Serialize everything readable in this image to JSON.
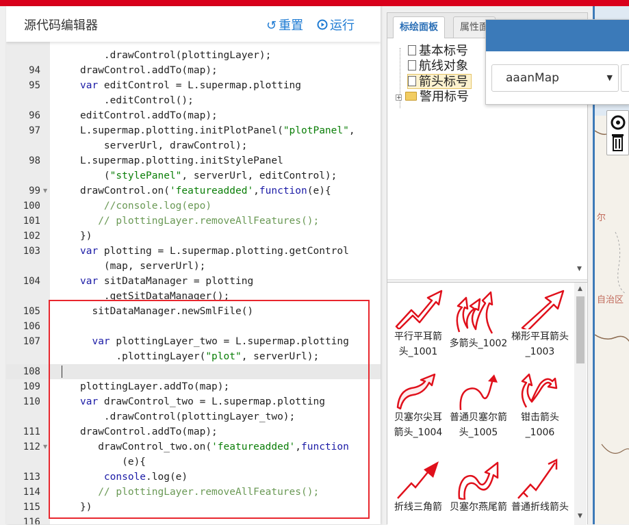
{
  "editor": {
    "title": "源代码编辑器",
    "reset_label": "重置",
    "run_label": "运行"
  },
  "code_lines": [
    {
      "num": "",
      "segs": [
        {
          "t": "    .drawControl(plottingLayer);",
          "c": ""
        }
      ]
    },
    {
      "num": "94",
      "segs": [
        {
          "t": "drawControl.addTo(map);",
          "c": ""
        }
      ]
    },
    {
      "num": "95",
      "segs": [
        {
          "t": "var",
          "c": "kw"
        },
        {
          "t": " editControl = L.supermap.plotting",
          "c": ""
        }
      ]
    },
    {
      "num": "",
      "segs": [
        {
          "t": "    .editControl();",
          "c": ""
        }
      ]
    },
    {
      "num": "96",
      "segs": [
        {
          "t": "editControl.addTo(map);",
          "c": ""
        }
      ]
    },
    {
      "num": "97",
      "segs": [
        {
          "t": "L.supermap.plotting.initPlotPanel(",
          "c": ""
        },
        {
          "t": "\"plotPanel\"",
          "c": "str"
        },
        {
          "t": ",",
          "c": ""
        }
      ]
    },
    {
      "num": "",
      "segs": [
        {
          "t": "    serverUrl, drawControl);",
          "c": ""
        }
      ]
    },
    {
      "num": "98",
      "segs": [
        {
          "t": "L.supermap.plotting.initStylePanel",
          "c": ""
        }
      ]
    },
    {
      "num": "",
      "segs": [
        {
          "t": "    (",
          "c": ""
        },
        {
          "t": "\"stylePanel\"",
          "c": "str"
        },
        {
          "t": ", serverUrl, editControl);",
          "c": ""
        }
      ]
    },
    {
      "num": "99",
      "segs": [
        {
          "t": "drawControl.on(",
          "c": ""
        },
        {
          "t": "'featureadded'",
          "c": "str"
        },
        {
          "t": ",",
          "c": ""
        },
        {
          "t": "function",
          "c": "kw"
        },
        {
          "t": "(e){",
          "c": ""
        }
      ]
    },
    {
      "num": "100",
      "segs": [
        {
          "t": "    //console.log(epo)",
          "c": "cm"
        }
      ]
    },
    {
      "num": "101",
      "segs": [
        {
          "t": "   // plottingLayer.removeAllFeatures();",
          "c": "cm"
        }
      ]
    },
    {
      "num": "102",
      "segs": [
        {
          "t": "})",
          "c": ""
        }
      ]
    },
    {
      "num": "103",
      "segs": [
        {
          "t": "var",
          "c": "kw"
        },
        {
          "t": " plotting = L.supermap.plotting.getControl",
          "c": ""
        }
      ]
    },
    {
      "num": "",
      "segs": [
        {
          "t": "    (map, serverUrl);",
          "c": ""
        }
      ]
    },
    {
      "num": "104",
      "segs": [
        {
          "t": "var",
          "c": "kw"
        },
        {
          "t": " sitDataManager = plotting",
          "c": ""
        }
      ]
    },
    {
      "num": "",
      "segs": [
        {
          "t": "    .getSitDataManager();",
          "c": ""
        }
      ]
    },
    {
      "num": "105",
      "segs": [
        {
          "t": "  sitDataManager.newSmlFile()",
          "c": ""
        }
      ]
    },
    {
      "num": "106",
      "segs": [
        {
          "t": "",
          "c": ""
        }
      ]
    },
    {
      "num": "107",
      "segs": [
        {
          "t": "  ",
          "c": ""
        },
        {
          "t": "var",
          "c": "kw"
        },
        {
          "t": " plottingLayer_two = L.supermap.plotting",
          "c": ""
        }
      ]
    },
    {
      "num": "",
      "segs": [
        {
          "t": "      .plottingLayer(",
          "c": ""
        },
        {
          "t": "\"plot\"",
          "c": "str"
        },
        {
          "t": ", serverUrl);",
          "c": ""
        }
      ]
    },
    {
      "num": "108",
      "segs": [
        {
          "t": "",
          "c": ""
        }
      ]
    },
    {
      "num": "109",
      "segs": [
        {
          "t": "plottingLayer.addTo(map);",
          "c": ""
        }
      ]
    },
    {
      "num": "110",
      "segs": [
        {
          "t": "var",
          "c": "kw"
        },
        {
          "t": " drawControl_two = L.supermap.plotting",
          "c": ""
        }
      ]
    },
    {
      "num": "",
      "segs": [
        {
          "t": "    .drawControl(plottingLayer_two);",
          "c": ""
        }
      ]
    },
    {
      "num": "111",
      "segs": [
        {
          "t": "drawControl.addTo(map);",
          "c": ""
        }
      ]
    },
    {
      "num": "112",
      "segs": [
        {
          "t": "   drawControl_two.on(",
          "c": ""
        },
        {
          "t": "'featureadded'",
          "c": "str"
        },
        {
          "t": ",",
          "c": ""
        },
        {
          "t": "function",
          "c": "kw"
        },
        {
          "t": "",
          "c": ""
        }
      ]
    },
    {
      "num": "",
      "segs": [
        {
          "t": "       (e){",
          "c": ""
        }
      ]
    },
    {
      "num": "113",
      "segs": [
        {
          "t": "    console",
          "c": "kw"
        },
        {
          "t": ".log(e)",
          "c": ""
        }
      ]
    },
    {
      "num": "114",
      "segs": [
        {
          "t": "   // plottingLayer.removeAllFeatures();",
          "c": "cm"
        }
      ]
    },
    {
      "num": "115",
      "segs": [
        {
          "t": "})",
          "c": ""
        }
      ]
    },
    {
      "num": "116",
      "segs": [
        {
          "t": "",
          "c": ""
        }
      ]
    }
  ],
  "plot_panel": {
    "tab_active": "标绘面板",
    "tab_other": "属性面",
    "tree": [
      {
        "label": "基本标号",
        "type": "doc"
      },
      {
        "label": "航线对象",
        "type": "doc"
      },
      {
        "label": "箭头标号",
        "type": "doc",
        "selected": true
      },
      {
        "label": "警用标号",
        "type": "folder"
      }
    ],
    "expand_symbol": "+",
    "symbols": [
      {
        "line1": "平行平耳箭",
        "line2": "头_1001"
      },
      {
        "line1": "多箭头_1002",
        "line2": ""
      },
      {
        "line1": "梯形平耳箭头",
        "line2": "_1003"
      },
      {
        "line1": "贝塞尔尖耳",
        "line2": "箭头_1004"
      },
      {
        "line1": "普通贝塞尔箭",
        "line2": "头_1005"
      },
      {
        "line1": "钳击箭头",
        "line2": "_1006"
      },
      {
        "line1": "折线三角箭",
        "line2": ""
      },
      {
        "line1": "贝塞尔燕尾箭",
        "line2": ""
      },
      {
        "line1": "普通折线箭头",
        "line2": ""
      }
    ]
  },
  "map": {
    "select_value": "aaanMap",
    "label_er": "尔",
    "label_zizhiqu": "自治区",
    "colors": {
      "accent": "#3b7ab9",
      "arrow": "#e0101b",
      "highlight": "#e8262d"
    }
  }
}
